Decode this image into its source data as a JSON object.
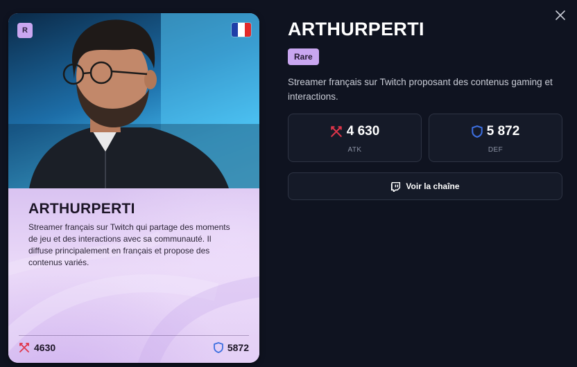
{
  "card": {
    "rarity_letter": "R",
    "name": "ARTHURPERTI",
    "description": "Streamer français sur Twitch qui partage des moments de jeu et des interactions avec sa communauté. Il diffuse principalement en français et propose des contenus variés.",
    "atk": "4630",
    "def": "5872",
    "flag_colors": [
      "#1f3fa8",
      "#ffffff",
      "#e22a2a"
    ]
  },
  "detail": {
    "title": "ARTHURPERTI",
    "rarity": "Rare",
    "description": "Streamer français sur Twitch proposant des contenus gaming et interactions.",
    "atk_value": "4 630",
    "atk_label": "ATK",
    "def_value": "5 872",
    "def_label": "DEF",
    "channel_button": "Voir la chaîne"
  },
  "icons": {
    "close": "close-icon",
    "atk": "crossed-swords-icon",
    "def": "shield-icon",
    "twitch": "twitch-icon"
  },
  "colors": {
    "background": "#0f1320",
    "rarity": "#c9a6f0",
    "atk": "#e0354a",
    "def": "#3d6fe0"
  }
}
